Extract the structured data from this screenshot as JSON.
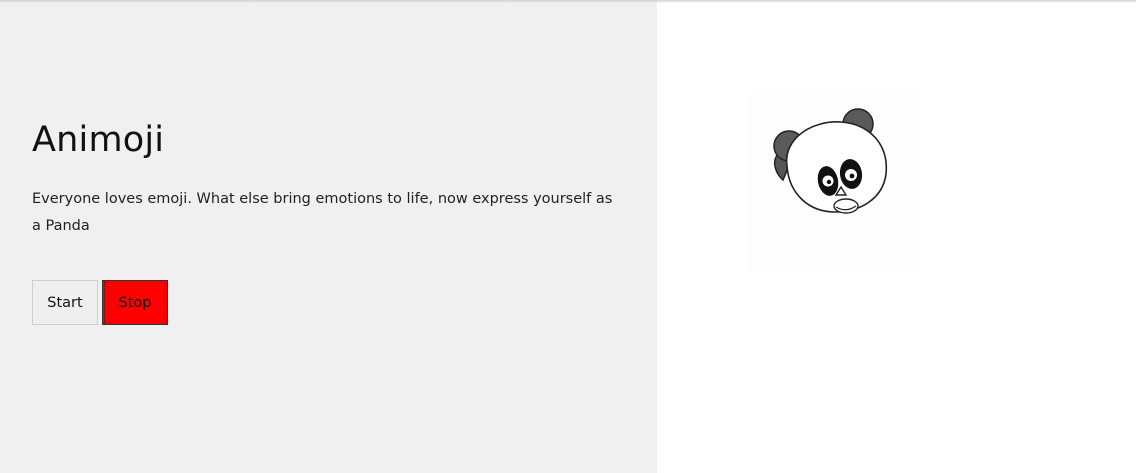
{
  "hero": {
    "title": "Animoji",
    "description": "Everyone loves emoji. What else bring emotions to life, now express yourself as a Panda"
  },
  "controls": {
    "start_label": "Start",
    "stop_label": "Stop"
  },
  "colors": {
    "left_panel_bg": "#f0f0f0",
    "stop_button_bg": "#ff0000",
    "start_button_bg": "#efefef"
  },
  "emoji": {
    "icon": "panda-face-icon"
  }
}
